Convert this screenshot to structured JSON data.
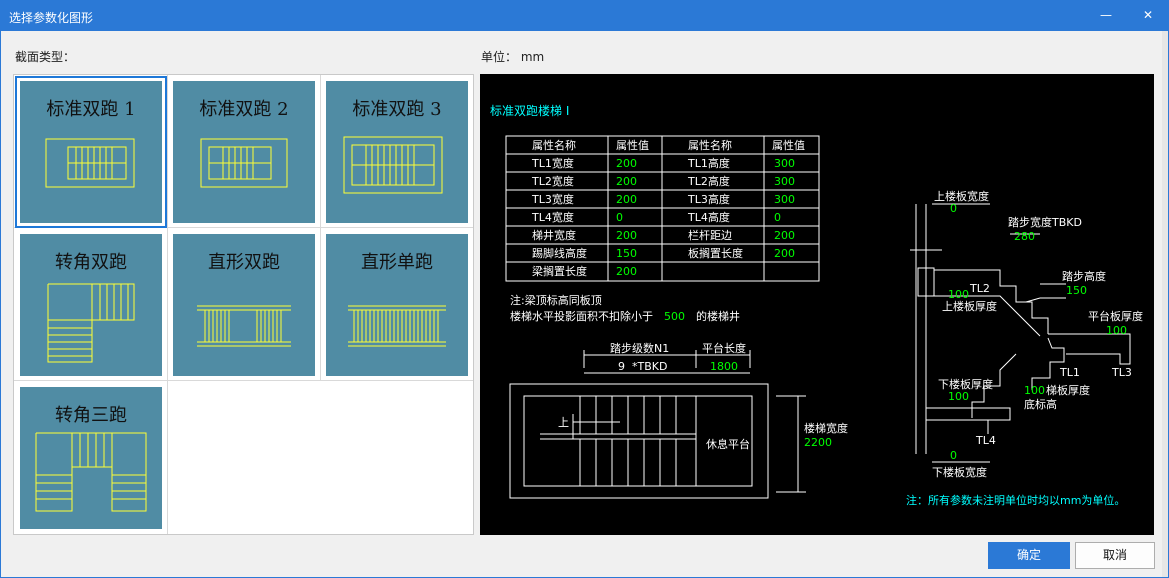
{
  "window": {
    "title": "选择参数化图形",
    "minimize_icon": "minimize-icon",
    "close_icon": "close-icon",
    "minimize_glyph": "—",
    "close_glyph": "✕"
  },
  "section_label": "截面类型：",
  "unit_label": "单位：   mm",
  "thumbnails": [
    {
      "label": "标准双跑 1",
      "selected": true
    },
    {
      "label": "标准双跑 2",
      "selected": false
    },
    {
      "label": "标准双跑 3",
      "selected": false
    },
    {
      "label": "转角双跑",
      "selected": false
    },
    {
      "label": "直形双跑",
      "selected": false
    },
    {
      "label": "直形单跑",
      "selected": false
    },
    {
      "label": "转角三跑",
      "selected": false
    }
  ],
  "preview": {
    "title": "标准双跑楼梯 I",
    "table_headers": [
      "属性名称",
      "属性值",
      "属性名称",
      "属性值"
    ],
    "table_rows": [
      [
        "TL1宽度",
        "200",
        "TL1高度",
        "300"
      ],
      [
        "TL2宽度",
        "200",
        "TL2高度",
        "300"
      ],
      [
        "TL3宽度",
        "200",
        "TL3高度",
        "300"
      ],
      [
        "TL4宽度",
        "0",
        "TL4高度",
        "0"
      ],
      [
        "梯井宽度",
        "200",
        "栏杆距边",
        "200"
      ],
      [
        "踢脚线高度",
        "150",
        "板搁置长度",
        "200"
      ],
      [
        "梁搁置长度",
        "200",
        "",
        ""
      ]
    ],
    "note1": "注:梁顶标高同板顶",
    "note2_pre": "楼梯水平投影面积不扣除小于",
    "note2_value": "500",
    "note2_post": "的楼梯井",
    "plan": {
      "steps_label": "踏步级数N1",
      "steps_value": "9",
      "tbkd": "*TBKD",
      "platform_label": "平台长度",
      "platform_value": "1800",
      "up_label": "上",
      "rest_label": "休息平台",
      "width_label": "楼梯宽度",
      "width_value": "2200"
    },
    "section": {
      "upper_slab_width": "上楼板宽度",
      "upper_slab_width_value": "0",
      "tread_width": "踏步宽度TBKD",
      "tread_width_value": "280",
      "tl2": "TL2",
      "tl2_value": "100",
      "upper_slab_thickness": "上楼板厚度",
      "riser": "踏步高度",
      "riser_value": "150",
      "platform_thickness": "平台板厚度",
      "platform_thickness_value": "100",
      "lower_slab_thickness": "下楼板厚度",
      "lower_slab_thickness_value": "100",
      "stair_slab_value": "100",
      "stair_slab_thickness": "梯板厚度",
      "tl1": "TL1",
      "tl3": "TL3",
      "bottom_elev": "底标高",
      "tl4": "TL4",
      "lower_slab_width_value": "0",
      "lower_slab_width": "下楼板宽度"
    },
    "footnote": "注：所有参数未注明单位时均以mm为单位。"
  },
  "buttons": {
    "ok": "确定",
    "cancel": "取消"
  },
  "colors": {
    "title_bar": "#2b79d6",
    "thumb_bg": "#508ca4",
    "cad_white": "#ffffff",
    "cad_green": "#00ff00",
    "cad_cyan": "#00ffff",
    "cad_yellow": "#ffff00"
  }
}
